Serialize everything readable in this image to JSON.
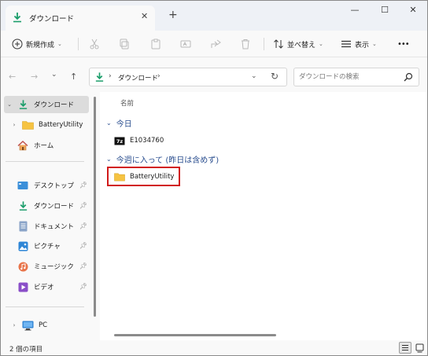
{
  "window": {
    "tab_title": "ダウンロード",
    "tab_close": "✕",
    "new_tab": "+",
    "minimize": "—",
    "maximize": "☐",
    "close": "✕"
  },
  "toolbar": {
    "new_label": "新規作成",
    "sort_label": "並べ替え",
    "view_label": "表示",
    "more_label": "•••"
  },
  "navigation": {
    "back": "←",
    "forward": "→",
    "recent": "⌄",
    "up": "↑",
    "breadcrumb": [
      "ダウンロード"
    ],
    "crumb_sep": "›",
    "search_placeholder": "ダウンロードの検索"
  },
  "sidebar": {
    "items": [
      {
        "label": "ダウンロード",
        "icon": "download-icon",
        "expand": "⌄"
      },
      {
        "label": "BatteryUtility",
        "icon": "folder-icon",
        "expand": "›"
      },
      {
        "label": "ホーム",
        "icon": "home-icon"
      }
    ],
    "quick_access": [
      {
        "label": "デスクトップ",
        "icon": "desktop-icon"
      },
      {
        "label": "ダウンロード",
        "icon": "download-icon"
      },
      {
        "label": "ドキュメント",
        "icon": "document-icon"
      },
      {
        "label": "ピクチャ",
        "icon": "pictures-icon"
      },
      {
        "label": "ミュージック",
        "icon": "music-icon"
      },
      {
        "label": "ビデオ",
        "icon": "video-icon"
      }
    ],
    "pc": {
      "label": "PC",
      "icon": "pc-icon",
      "expand": "›"
    }
  },
  "content": {
    "column_name": "名前",
    "groups": [
      {
        "title": "今日",
        "items": [
          {
            "name": "E1034760",
            "icon": "7z-archive-icon"
          }
        ]
      },
      {
        "title": "今週に入って (昨日は含めず)",
        "items": [
          {
            "name": "BatteryUtility",
            "icon": "folder-icon"
          }
        ]
      }
    ]
  },
  "status": {
    "item_count": "2 個の項目"
  },
  "colors": {
    "accent": "#1a9d6a",
    "group_header": "#2a4e8f",
    "folder": "#f6c342",
    "highlight": "#d11a1a"
  }
}
